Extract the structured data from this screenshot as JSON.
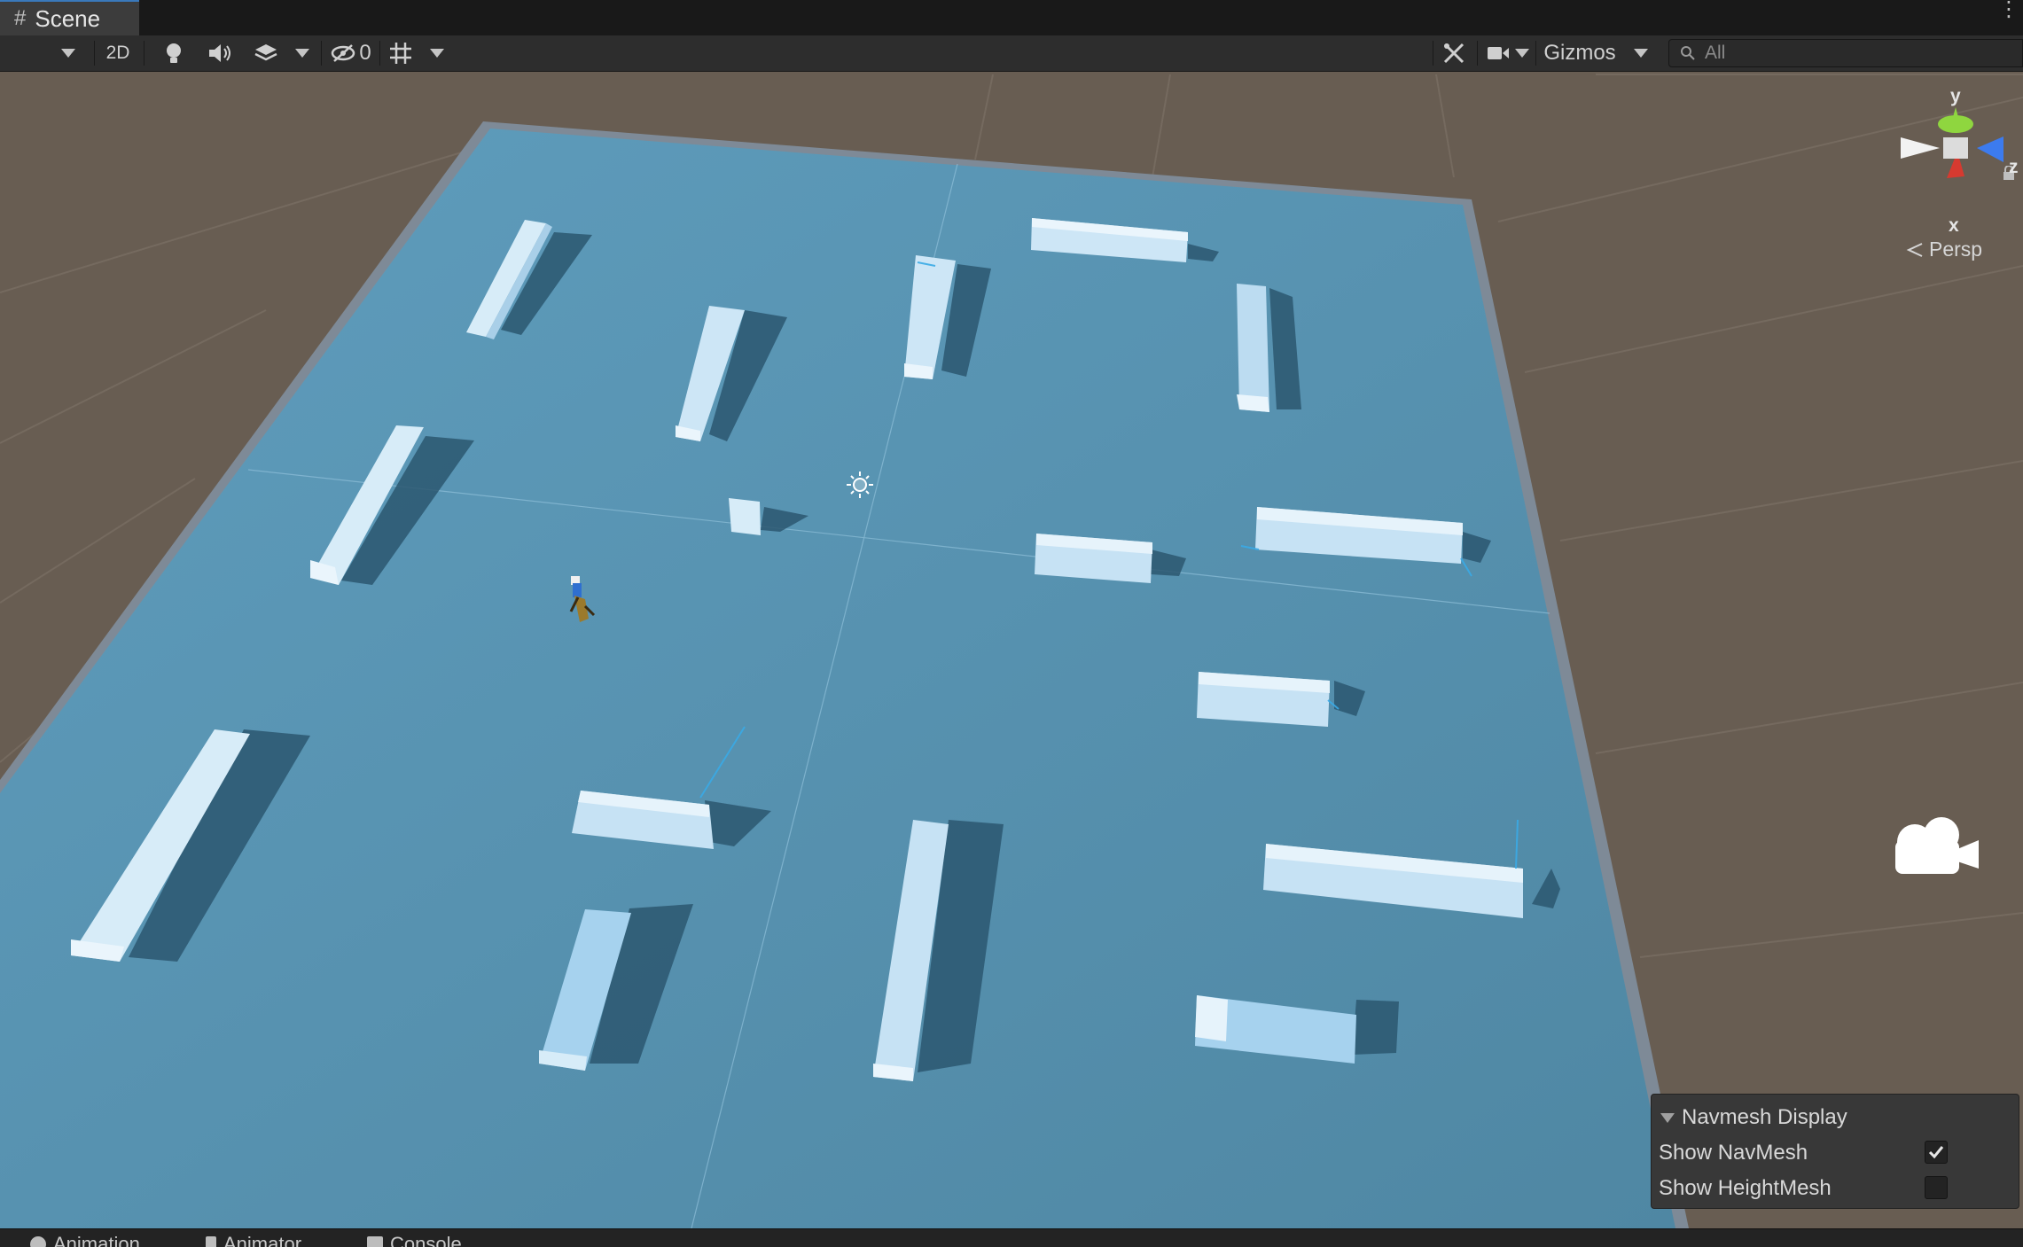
{
  "window": {
    "tab_label": "Scene"
  },
  "toolbar": {
    "mode_2d": "2D",
    "hidden_count": "0",
    "gizmos_label": "Gizmos",
    "search_placeholder": "All"
  },
  "gizmo": {
    "axis_x": "x",
    "axis_y": "y",
    "axis_z": "z",
    "projection": "Persp"
  },
  "navmesh_overlay": {
    "title": "Navmesh Display",
    "show_navmesh": {
      "label": "Show NavMesh",
      "checked": true
    },
    "show_heightmesh": {
      "label": "Show HeightMesh",
      "checked": false
    }
  },
  "bottom_tabs": [
    "Animation",
    "Animator",
    "Console"
  ],
  "colors": {
    "ground": "#685d52",
    "plane": "#5b93b0",
    "navmesh": "#4aa8dd",
    "obstacle": "#c6e2f4",
    "shadow": "#2c5770",
    "accent": "#3a79bb"
  }
}
